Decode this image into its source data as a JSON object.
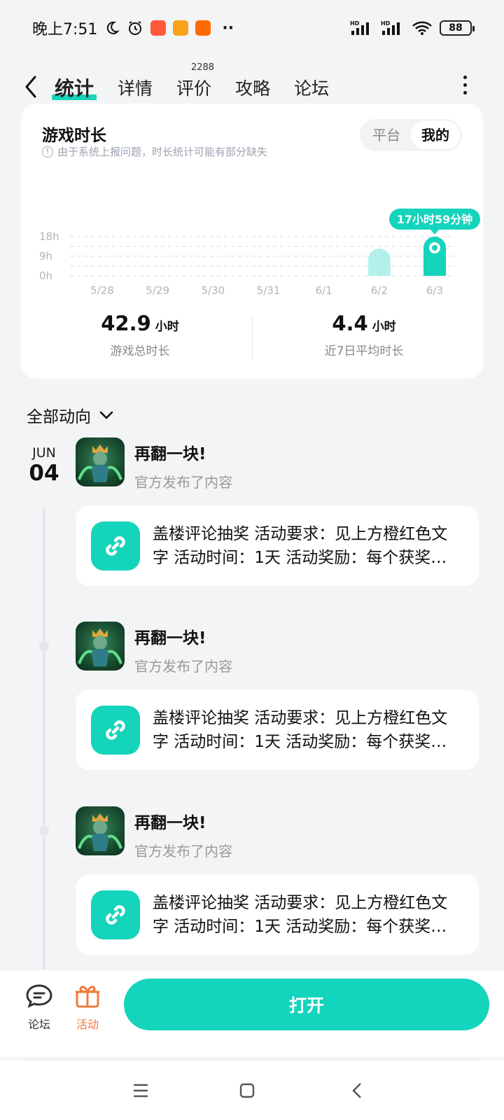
{
  "status_bar": {
    "time": "晚上7:51",
    "battery": "88",
    "signal1_label": "HD",
    "signal2_label": "HD",
    "more_dots": "··"
  },
  "header": {
    "tabs": [
      {
        "label": "统计",
        "active": true
      },
      {
        "label": "详情"
      },
      {
        "label": "评价",
        "badge": "2288"
      },
      {
        "label": "攻略"
      },
      {
        "label": "论坛"
      }
    ]
  },
  "stats": {
    "title": "游戏时长",
    "notice": "由于系统上报问题，时长统计可能有部分缺失",
    "toggle": {
      "options": [
        "平台",
        "我的"
      ],
      "selected": "我的"
    },
    "total": {
      "value": "42.9",
      "unit": "小时",
      "label": "游戏总时长"
    },
    "average": {
      "value": "4.4",
      "unit": "小时",
      "label": "近7日平均时长"
    },
    "accent_color": "#14d4bc",
    "light_color": "#b4f0ea"
  },
  "chart_data": {
    "type": "bar",
    "categories": [
      "5/28",
      "5/29",
      "5/30",
      "5/31",
      "6/1",
      "6/2",
      "6/3"
    ],
    "values": [
      0,
      0,
      0,
      0,
      0,
      12.5,
      17.98
    ],
    "ytick_labels": [
      "18h",
      "9h",
      "0h"
    ],
    "ylim": [
      0,
      18
    ],
    "highlight_index": 6,
    "highlight_label": "17小时59分钟",
    "grid": true
  },
  "feed": {
    "header": "全部动向",
    "date": {
      "month": "JUN",
      "day": "04"
    },
    "posts": [
      {
        "title": "再翻一块!",
        "subtitle": "官方发布了内容",
        "text": "盖楼评论抽奖 活动要求：见上方橙红色文字 活动时间：1天 活动奖励：每个获奖玩家"
      },
      {
        "title": "再翻一块!",
        "subtitle": "官方发布了内容",
        "text": "盖楼评论抽奖 活动要求：见上方橙红色文字 活动时间：1天 活动奖励：每个获奖玩家"
      },
      {
        "title": "再翻一块!",
        "subtitle": "官方发布了内容",
        "text": "盖楼评论抽奖 活动要求：见上方橙红色文字 活动时间：1天 活动奖励：每个获奖玩家"
      }
    ]
  },
  "bottom": {
    "forum_label": "论坛",
    "activity_label": "活动",
    "open_label": "打开",
    "activity_color": "#f07a3a"
  }
}
